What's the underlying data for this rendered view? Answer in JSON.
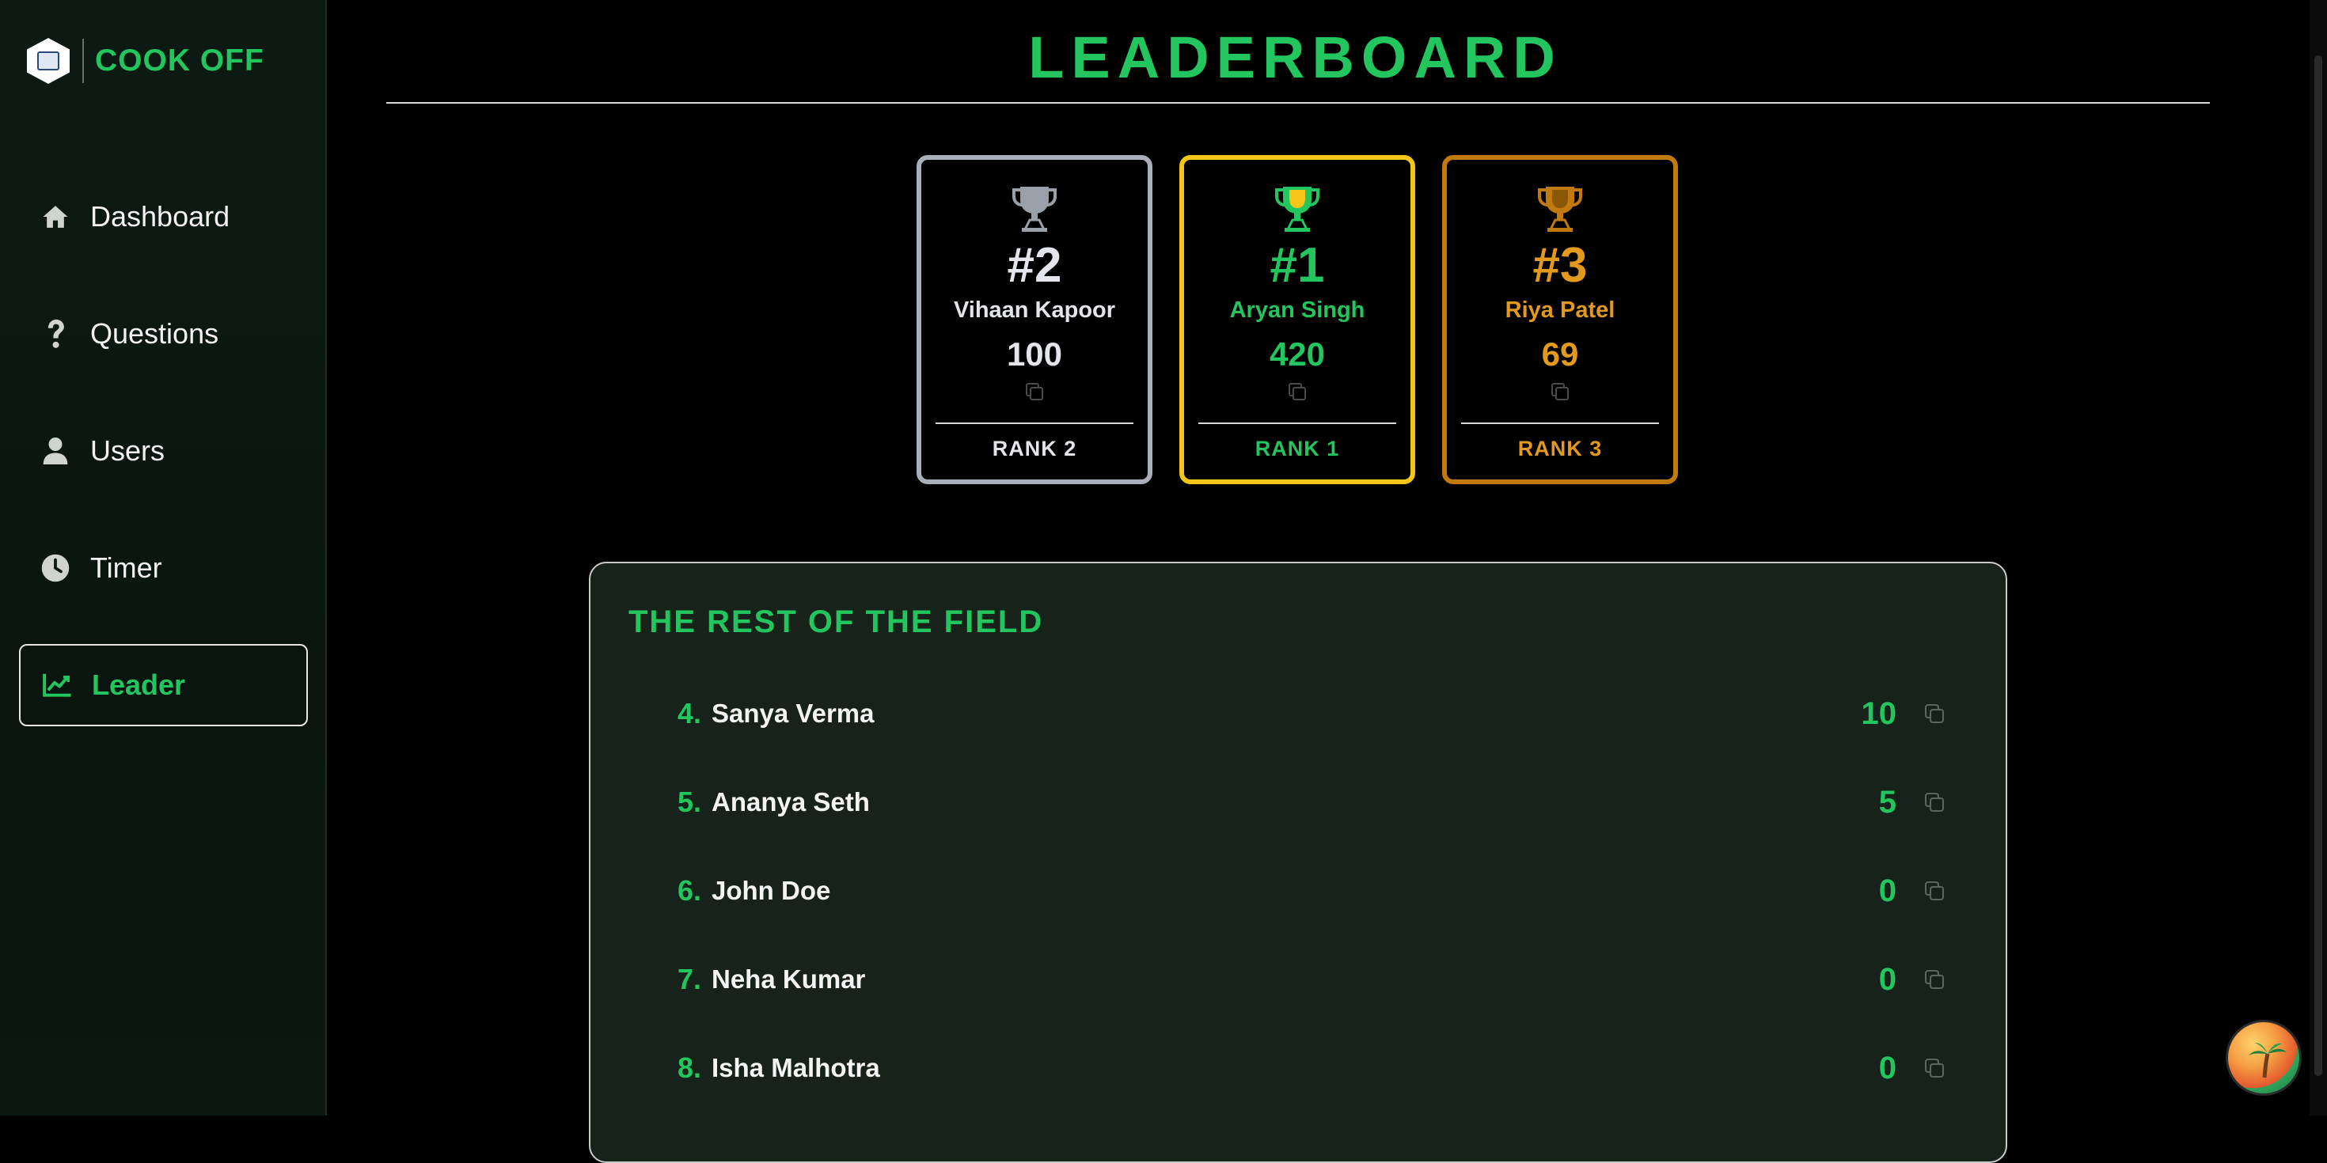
{
  "brand": {
    "name": "COOK OFF"
  },
  "nav": {
    "items": [
      {
        "label": "Dashboard",
        "icon": "home-icon"
      },
      {
        "label": "Questions",
        "icon": "question-icon"
      },
      {
        "label": "Users",
        "icon": "user-icon"
      },
      {
        "label": "Timer",
        "icon": "clock-icon"
      },
      {
        "label": "Leader",
        "icon": "chart-line-icon",
        "active": true
      }
    ]
  },
  "page": {
    "title": "LEADERBOARD"
  },
  "podium": [
    {
      "position": "#2",
      "name": "Vihaan Kapoor",
      "score": "100",
      "rank_label": "RANK 2"
    },
    {
      "position": "#1",
      "name": "Aryan Singh",
      "score": "420",
      "rank_label": "RANK 1"
    },
    {
      "position": "#3",
      "name": "Riya Patel",
      "score": "69",
      "rank_label": "RANK 3"
    }
  ],
  "field": {
    "title": "THE REST OF THE FIELD",
    "rows": [
      {
        "num": "4.",
        "name": "Sanya Verma",
        "score": "10"
      },
      {
        "num": "5.",
        "name": "Ananya Seth",
        "score": "5"
      },
      {
        "num": "6.",
        "name": "John Doe",
        "score": "0"
      },
      {
        "num": "7.",
        "name": "Neha Kumar",
        "score": "0"
      },
      {
        "num": "8.",
        "name": "Isha Malhotra",
        "score": "0"
      }
    ]
  },
  "colors": {
    "accent": "#22c55e",
    "gold": "#f5c518",
    "silver": "#a9aeb8",
    "bronze": "#c27a0e"
  }
}
